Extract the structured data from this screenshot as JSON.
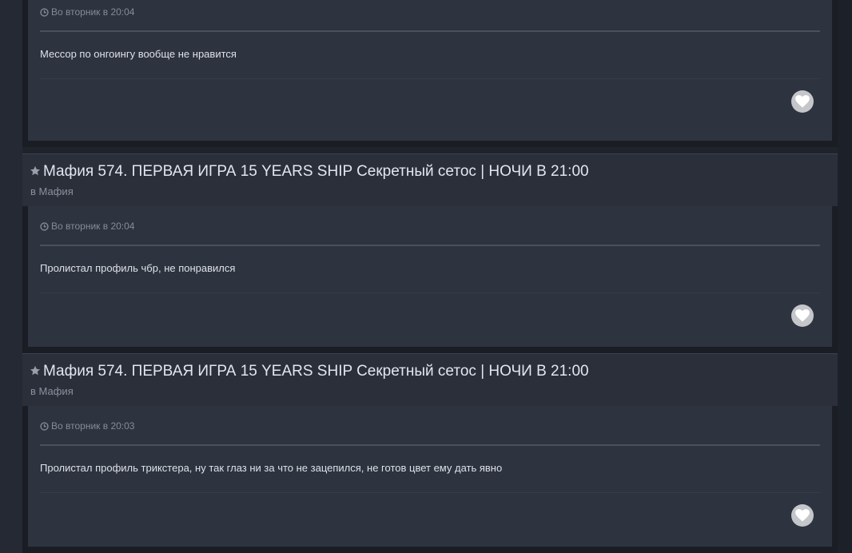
{
  "posts": [
    {
      "title": "",
      "forum_prefix": "",
      "forum_name": "",
      "date": "Во вторник в 20:04",
      "text": "Мессор по онгоингу вообще не нравится"
    },
    {
      "title": "Мафия 574. ПЕРВАЯ ИГРА 15 YEARS SHIP Секретный сетос | НОЧИ В 21:00",
      "forum_prefix": "в",
      "forum_name": "Мафия",
      "date": "Во вторник в 20:04",
      "text": "Пролистал профиль чбр, не понравился"
    },
    {
      "title": "Мафия 574. ПЕРВАЯ ИГРА 15 YEARS SHIP Секретный сетос | НОЧИ В 21:00",
      "forum_prefix": "в",
      "forum_name": "Мафия",
      "date": "Во вторник в 20:03",
      "text": "Пролистал профиль трикстера, ну так глаз ни за что не зацепился, не готов цвет ему дать явно"
    }
  ],
  "icons": {
    "star": "star-icon",
    "clock": "clock-icon",
    "like": "heart-icon"
  },
  "colors": {
    "background": "#1f232b",
    "post_background": "#2d333f",
    "header_background": "#2a2f3a",
    "like_button": "#c4c6ca"
  }
}
